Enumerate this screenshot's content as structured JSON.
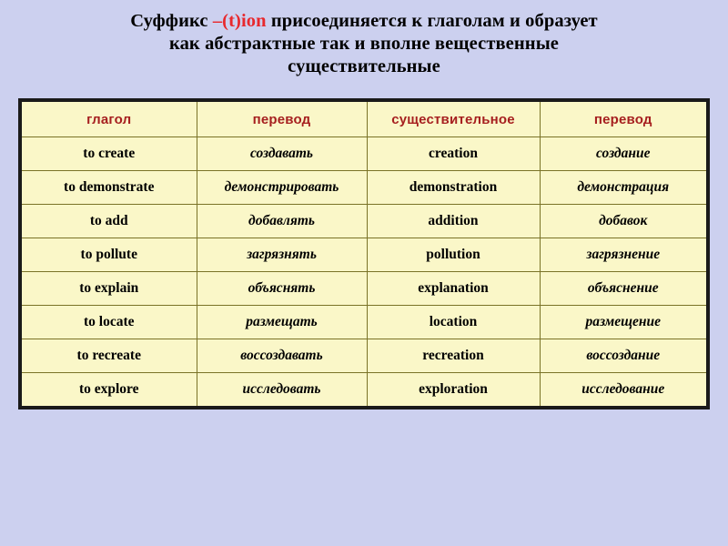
{
  "slide": {
    "background_color": "#ccd0ef",
    "title": {
      "line1_before": "Суффикс ",
      "line1_accent": "–(t)ion",
      "line1_after": " присоединяется к глаголам и образует",
      "line2": "как абстрактные так и вполне вещественные",
      "line3": "существительные",
      "accent_color": "#e8282d",
      "text_color": "#000000"
    }
  },
  "table": {
    "header_color": "#a61f1f",
    "cell_background": "#faf7c8",
    "grid_color": "#7a7327",
    "outer_border_color": "#1a1a1a",
    "headers": [
      "глагол",
      "перевод",
      "существительное",
      "перевод"
    ],
    "rows": [
      {
        "verb": "to create",
        "verb_translation": "создавать",
        "noun": "creation",
        "noun_translation": "создание"
      },
      {
        "verb": "to demonstrate",
        "verb_translation": "демонстрировать",
        "noun": "demonstration",
        "noun_translation": "демонстрация"
      },
      {
        "verb": "to add",
        "verb_translation": "добавлять",
        "noun": "addition",
        "noun_translation": "добавок"
      },
      {
        "verb": "to pollute",
        "verb_translation": "загрязнять",
        "noun": "pollution",
        "noun_translation": "загрязнение"
      },
      {
        "verb": "to explain",
        "verb_translation": "объяснять",
        "noun": "explanation",
        "noun_translation": "объяснение"
      },
      {
        "verb": "to locate",
        "verb_translation": "размещать",
        "noun": "location",
        "noun_translation": "размещение"
      },
      {
        "verb": "to recreate",
        "verb_translation": "воссоздавать",
        "noun": "recreation",
        "noun_translation": "воссоздание"
      },
      {
        "verb": "to explore",
        "verb_translation": "исследовать",
        "noun": "exploration",
        "noun_translation": "исследование"
      }
    ]
  }
}
